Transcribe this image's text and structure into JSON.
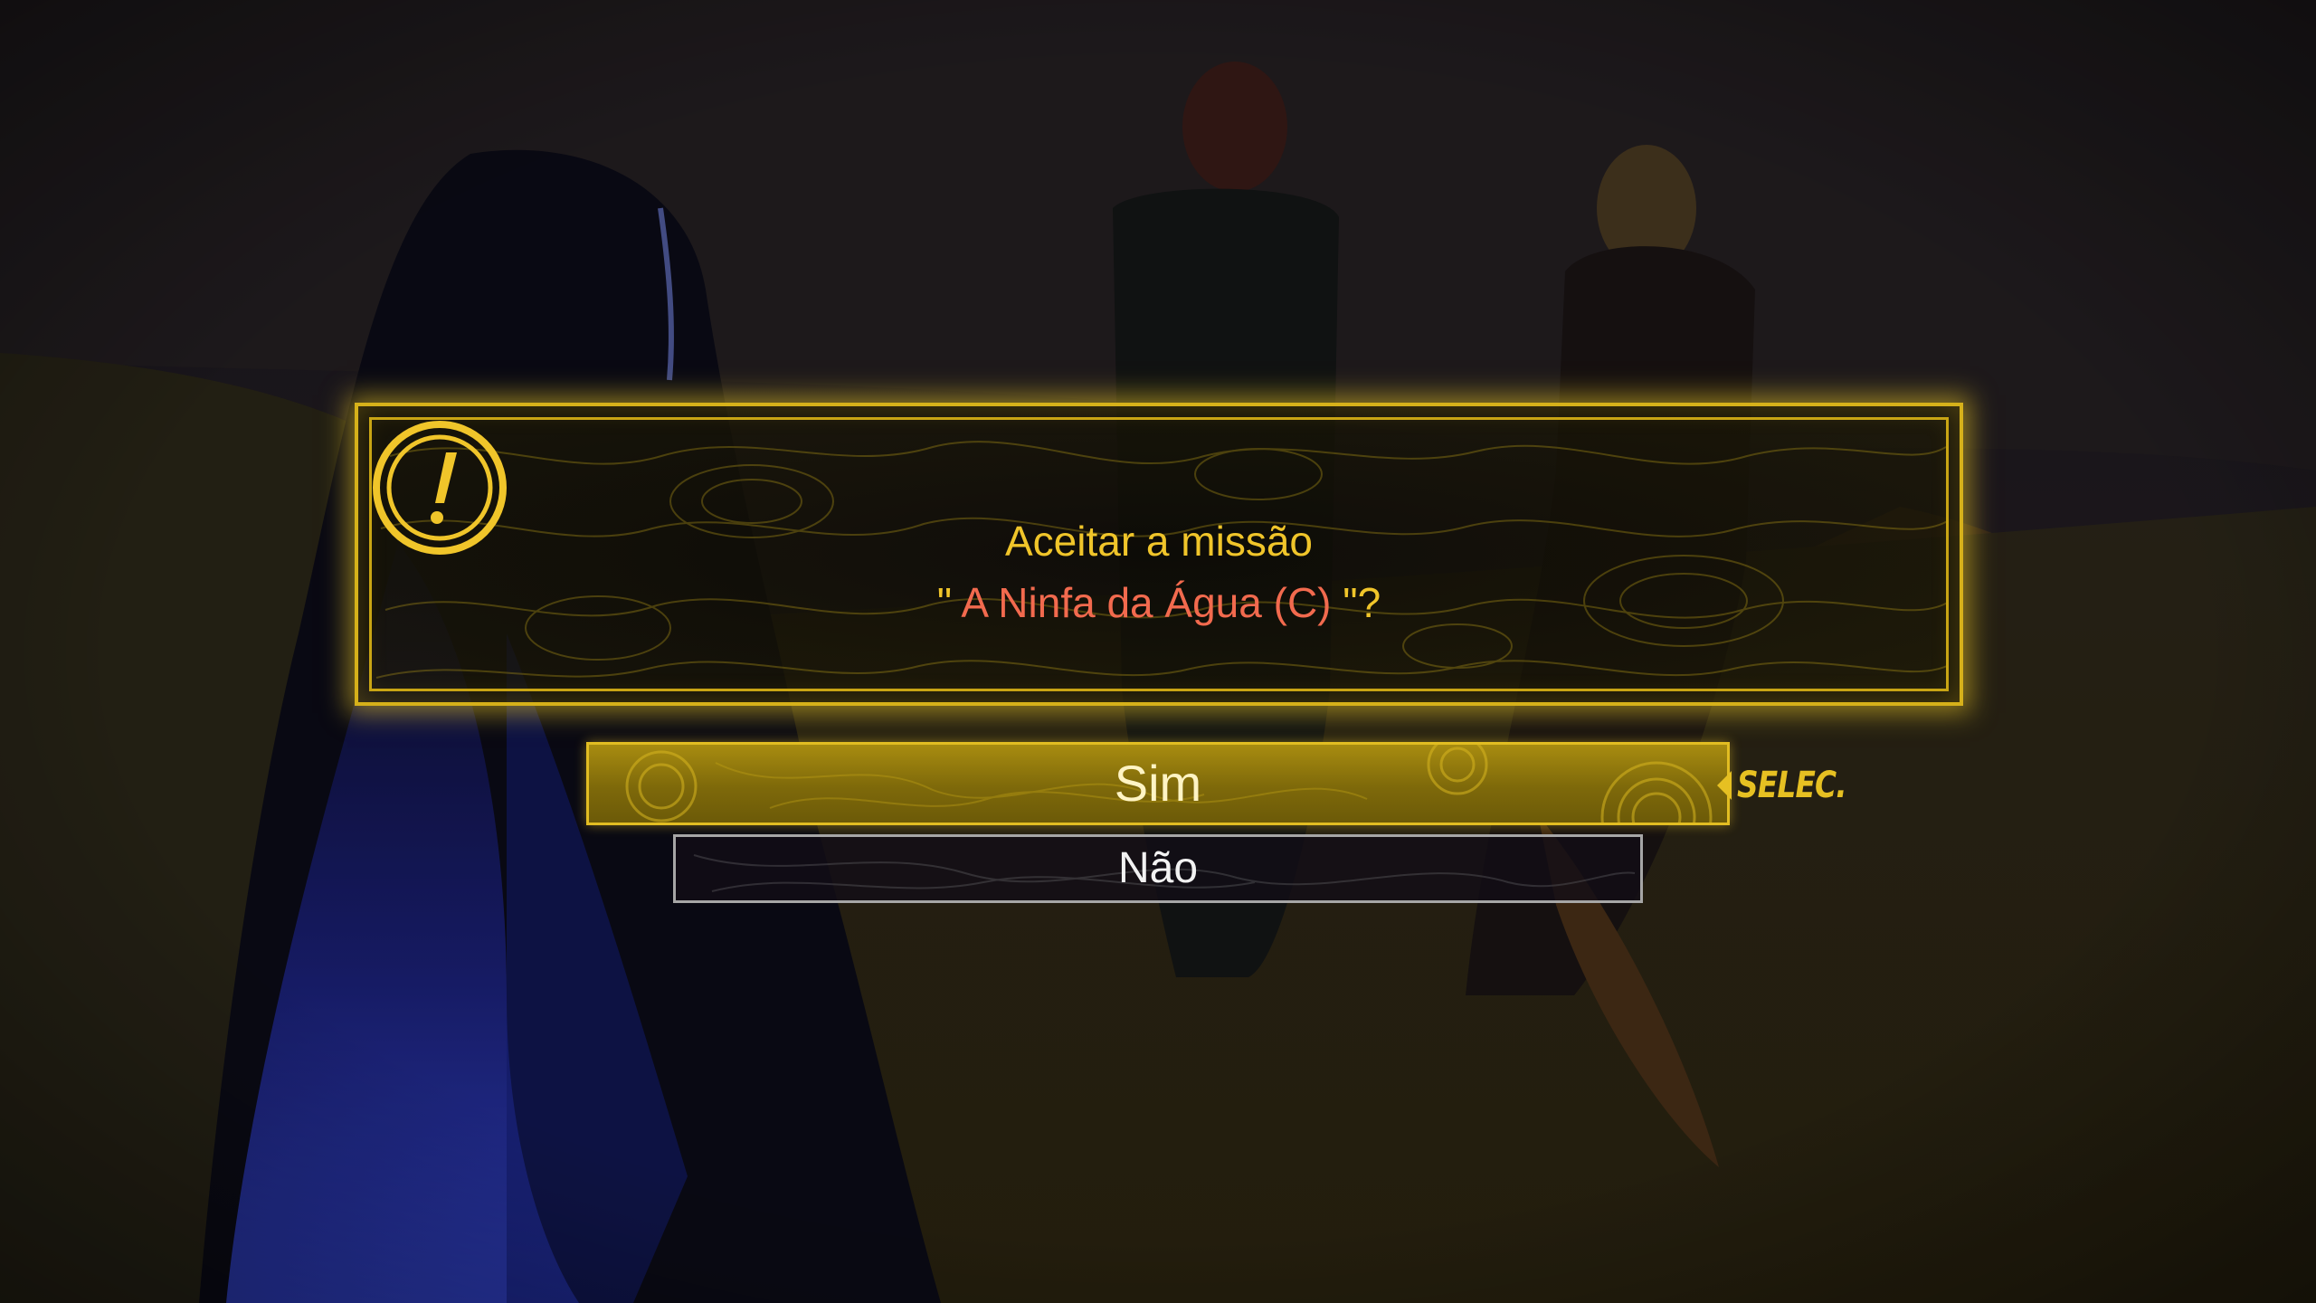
{
  "dialog": {
    "icon": "exclamation-circle-icon",
    "line1": "Aceitar a missão",
    "quote_open": "\" ",
    "quest_name": "A Ninfa da Água (C)",
    "quote_close": " \"?"
  },
  "options": {
    "yes_label": "Sim",
    "no_label": "Não"
  },
  "hint": {
    "select_label": "SELEC."
  },
  "colors": {
    "accent": "#e6c022",
    "quest_name": "#f26a4e",
    "option_selected": "#7e690a",
    "option_border_inactive": "#a6a6a6"
  }
}
